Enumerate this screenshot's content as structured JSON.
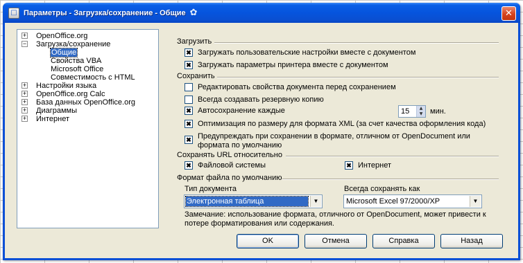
{
  "window": {
    "title": "Параметры - Загрузка/сохранение - Общие",
    "icon": "app-icon",
    "close_label": "✕"
  },
  "tree": {
    "items": [
      {
        "label": "OpenOffice.org",
        "level": 0,
        "expander": "+",
        "selected": false
      },
      {
        "label": "Загрузка/сохранение",
        "level": 0,
        "expander": "−",
        "selected": false
      },
      {
        "label": "Общие",
        "level": 1,
        "expander": "",
        "selected": true
      },
      {
        "label": "Свойства VBA",
        "level": 1,
        "expander": "",
        "selected": false
      },
      {
        "label": "Microsoft Office",
        "level": 1,
        "expander": "",
        "selected": false
      },
      {
        "label": "Совместимость с HTML",
        "level": 1,
        "expander": "",
        "selected": false
      },
      {
        "label": "Настройки языка",
        "level": 0,
        "expander": "+",
        "selected": false
      },
      {
        "label": "OpenOffice.org Calc",
        "level": 0,
        "expander": "+",
        "selected": false
      },
      {
        "label": "База данных OpenOffice.org",
        "level": 0,
        "expander": "+",
        "selected": false
      },
      {
        "label": "Диаграммы",
        "level": 0,
        "expander": "+",
        "selected": false
      },
      {
        "label": "Интернет",
        "level": 0,
        "expander": "+",
        "selected": false
      }
    ]
  },
  "load": {
    "title": "Загрузить",
    "user_settings": {
      "label": "Загружать пользовательские настройки вместе с документом",
      "checked": true
    },
    "printer_settings": {
      "label": "Загружать параметры принтера вместе с документом",
      "checked": true
    }
  },
  "save": {
    "title": "Сохранить",
    "edit_props": {
      "label": "Редактировать свойства документа перед сохранением",
      "checked": false
    },
    "backup": {
      "label": "Всегда создавать резервную копию",
      "checked": false
    },
    "autosave": {
      "label": "Автосохранение каждые",
      "checked": true,
      "value": "15",
      "unit": "мин."
    },
    "optimize_xml": {
      "label": "Оптимизация по размеру для формата XML (за счет качества оформления кода)",
      "checked": true
    },
    "warn_format": {
      "label_line1": "Предупреждать при сохранении в формате, отличном от OpenDocument или",
      "label_line2": "формата по умолчанию",
      "checked": true
    }
  },
  "url": {
    "title": "Сохранять URL относительно",
    "filesystem": {
      "label": "Файловой системы",
      "checked": true
    },
    "internet": {
      "label": "Интернет",
      "checked": true
    }
  },
  "default_format": {
    "title": "Формат файла по умолчанию",
    "doc_type_label": "Тип документа",
    "doc_type_value": "Электронная таблица",
    "save_as_label": "Всегда сохранять как",
    "save_as_value": "Microsoft Excel 97/2000/XP",
    "note_line1": "Замечание: использование формата, отличного от OpenDocument, может привести к",
    "note_line2": "потере форматирования или содержания."
  },
  "buttons": {
    "ok": "OK",
    "cancel": "Отмена",
    "help": "Справка",
    "back": "Назад"
  }
}
